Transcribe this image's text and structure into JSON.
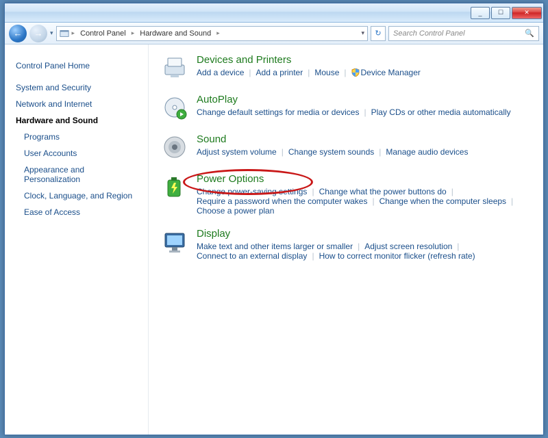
{
  "titlebar": {
    "min": "_",
    "max": "☐",
    "close": "✕"
  },
  "breadcrumb": {
    "root": "Control Panel",
    "current": "Hardware and Sound"
  },
  "search": {
    "placeholder": "Search Control Panel"
  },
  "sidebar": {
    "home": "Control Panel Home",
    "items": [
      "System and Security",
      "Network and Internet",
      "Hardware and Sound",
      "Programs",
      "User Accounts",
      "Appearance and Personalization",
      "Clock, Language, and Region",
      "Ease of Access"
    ],
    "current_index": 2
  },
  "sections": [
    {
      "title": "Devices and Printers",
      "links": [
        "Add a device",
        "Add a printer",
        "Mouse",
        "Device Manager"
      ],
      "shield_index": 3
    },
    {
      "title": "AutoPlay",
      "links": [
        "Change default settings for media or devices",
        "Play CDs or other media automatically"
      ]
    },
    {
      "title": "Sound",
      "links": [
        "Adjust system volume",
        "Change system sounds",
        "Manage audio devices"
      ]
    },
    {
      "title": "Power Options",
      "links": [
        "Change power-saving settings",
        "Change what the power buttons do",
        "Require a password when the computer wakes",
        "Change when the computer sleeps",
        "Choose a power plan"
      ],
      "highlighted": true
    },
    {
      "title": "Display",
      "links": [
        "Make text and other items larger or smaller",
        "Adjust screen resolution",
        "Connect to an external display",
        "How to correct monitor flicker (refresh rate)"
      ]
    }
  ]
}
